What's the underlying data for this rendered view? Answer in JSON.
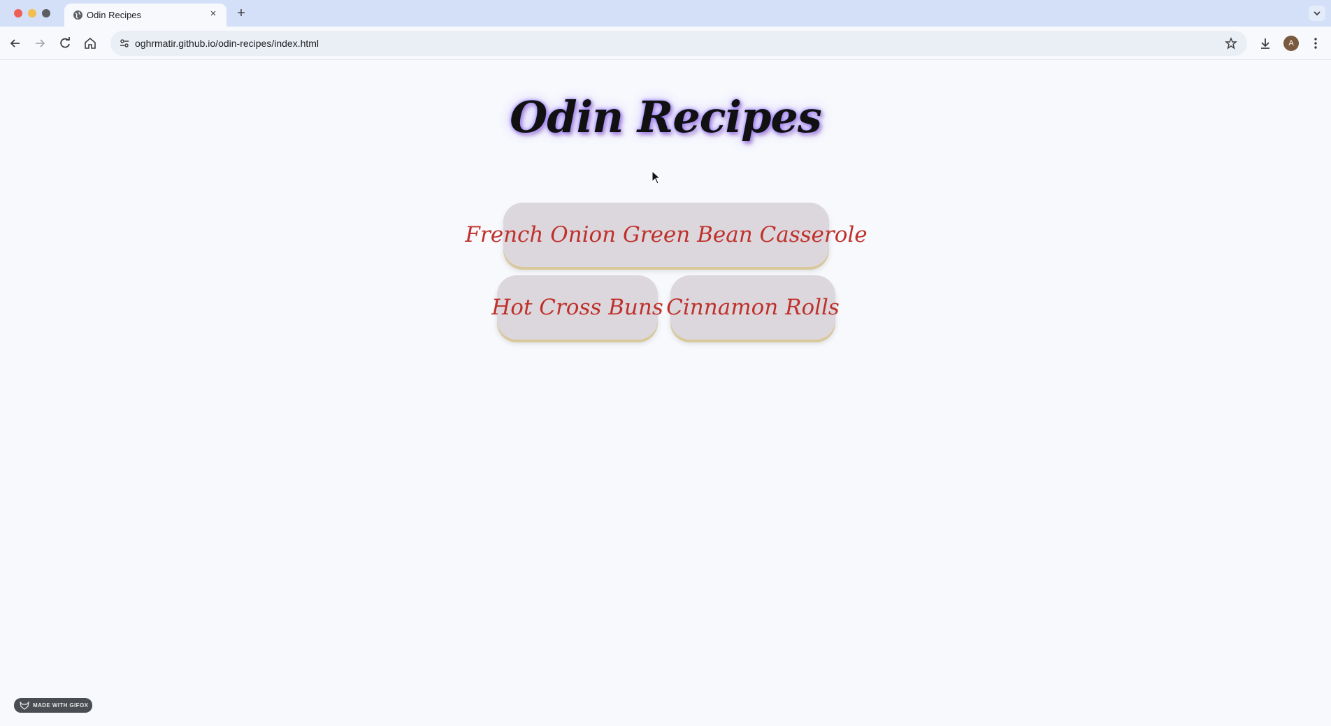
{
  "browser": {
    "tab_title": "Odin Recipes",
    "tab_close": "×",
    "new_tab": "+",
    "url": "oghrmatir.github.io/odin-recipes/index.html",
    "profile_initial": "A"
  },
  "page": {
    "title": "Odin Recipes",
    "recipes": [
      {
        "label": "French Onion Green Bean Casserole"
      },
      {
        "label": "Hot Cross Buns"
      },
      {
        "label": "Cinnamon Rolls"
      }
    ],
    "badge": "MADE WITH GIFOX"
  },
  "colors": {
    "background": "#f7f9fd",
    "tabbar": "#d3e0f7",
    "button_bg": "#dbd7dd",
    "button_text": "#c0302a",
    "title_glow": "#8a6cff"
  }
}
